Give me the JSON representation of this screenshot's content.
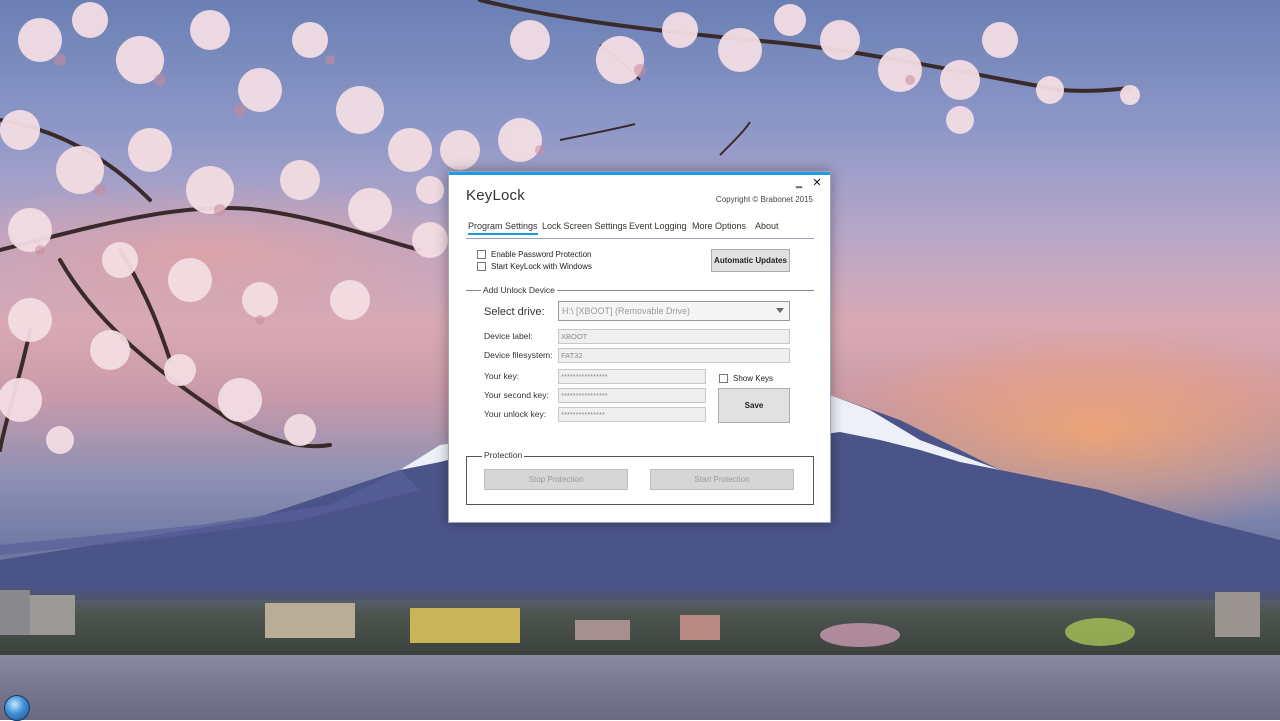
{
  "app": {
    "title": "KeyLock",
    "copyright": "Copyright © Brabonet 2015",
    "minimize_glyph": "‗",
    "close_glyph": "✕"
  },
  "tabs": [
    {
      "label": "Program Settings",
      "active": true
    },
    {
      "label": "Lock Screen Settings",
      "active": false
    },
    {
      "label": "Event Logging",
      "active": false
    },
    {
      "label": "More Options",
      "active": false
    },
    {
      "label": "About",
      "active": false
    }
  ],
  "program_settings": {
    "enable_password_protection": {
      "label": "Enable Password Protection",
      "checked": false
    },
    "start_with_windows": {
      "label": "Start KeyLock with Windows",
      "checked": false
    },
    "automatic_updates_label": "Automatic Updates"
  },
  "unlock_device": {
    "group_label": "Add Unlock Device",
    "select_drive_label": "Select drive:",
    "select_drive_value": "H:\\ [XBOOT] (Removable Drive)",
    "device_label_label": "Device label:",
    "device_label_value": "XBOOT",
    "device_fs_label": "Device filesystem:",
    "device_fs_value": "FAT32",
    "your_key_label": "Your key:",
    "your_key_value": "****************",
    "second_key_label": "Your second key:",
    "second_key_value": "****************",
    "unlock_key_label": "Your unlock key:",
    "unlock_key_value": "***************",
    "show_keys": {
      "label": "Show Keys",
      "checked": false
    },
    "save_label": "Save"
  },
  "protection": {
    "group_label": "Protection",
    "stop_label": "Stop Protection",
    "start_label": "Start Protection"
  },
  "colors": {
    "accent": "#1e9ae0",
    "window_bg": "#ffffff"
  },
  "icons": {
    "start": "windows-start-orb-icon"
  }
}
